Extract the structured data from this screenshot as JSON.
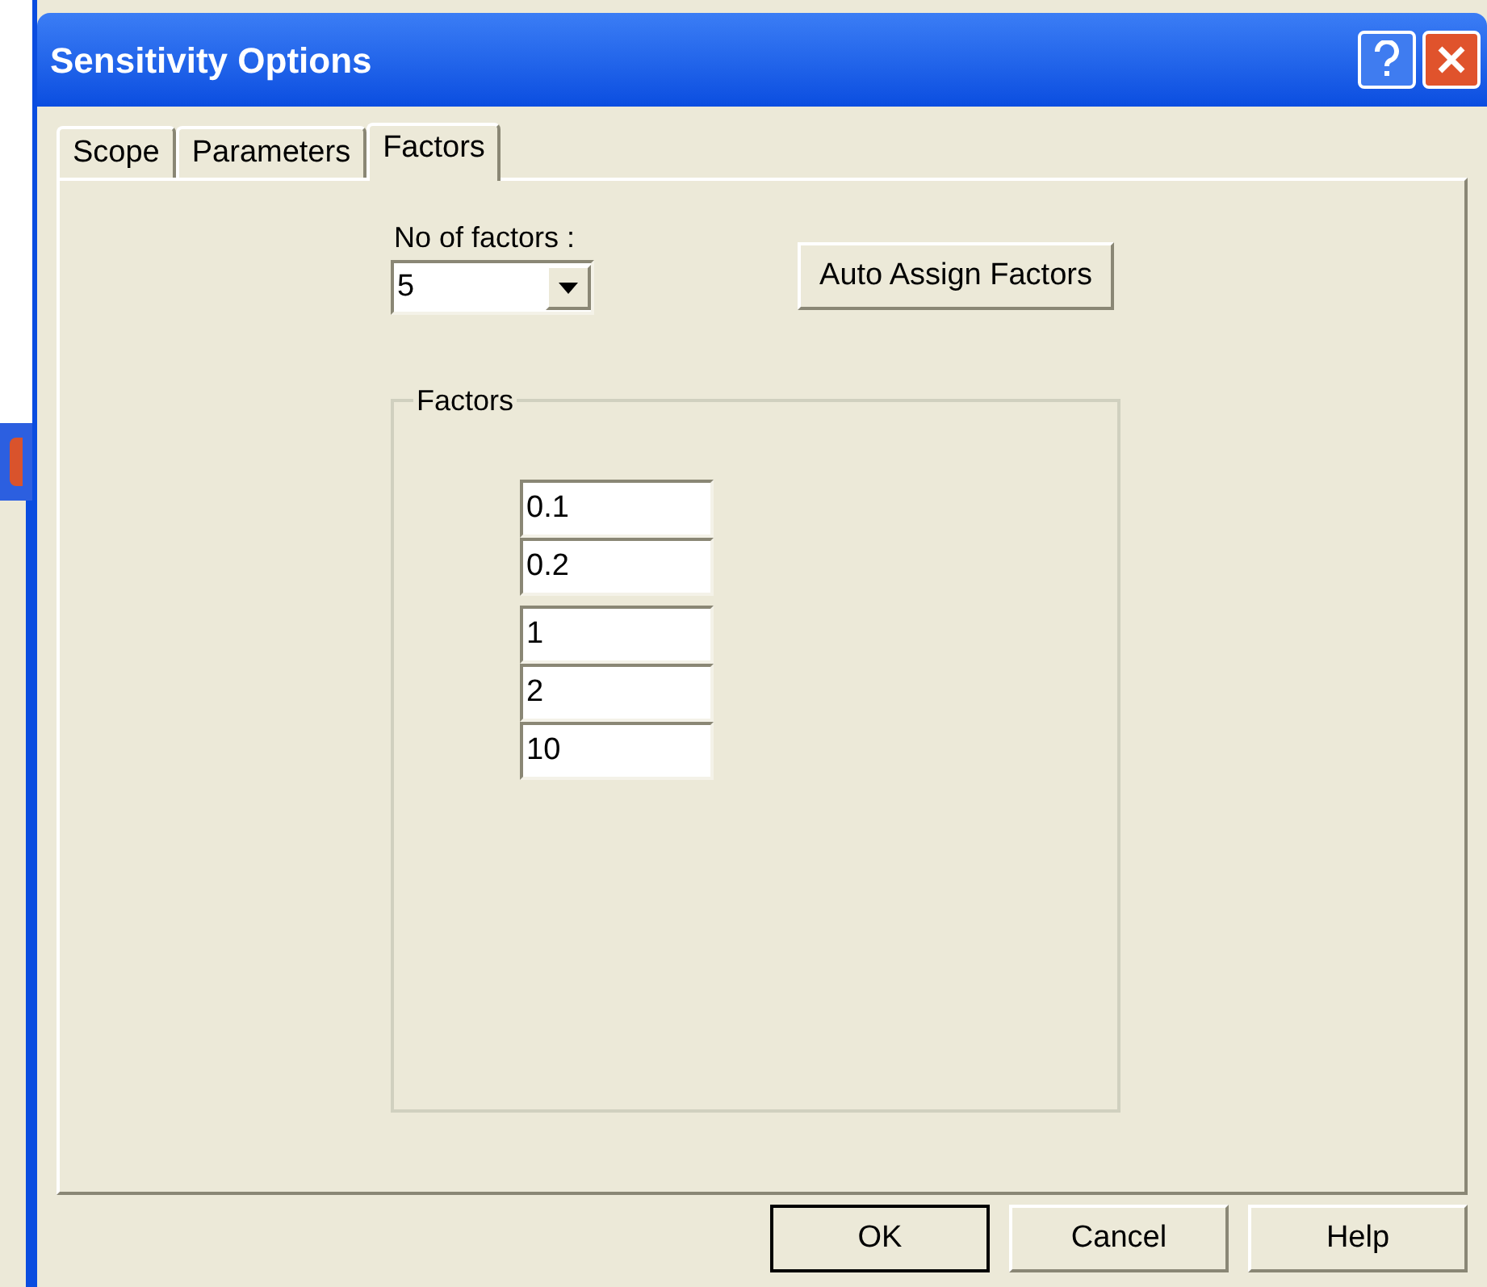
{
  "window": {
    "title": "Sensitivity Options"
  },
  "tabs": [
    {
      "label": "Scope",
      "selected": false
    },
    {
      "label": "Parameters",
      "selected": false
    },
    {
      "label": "Factors",
      "selected": true
    }
  ],
  "no_of_factors": {
    "label": "No of factors :",
    "value": "5"
  },
  "auto_assign_button": "Auto Assign Factors",
  "factors_group": {
    "title": "Factors",
    "values": [
      "0.1",
      "0.2",
      "1",
      "2",
      "10"
    ]
  },
  "buttons": [
    {
      "label": "OK",
      "default": true
    },
    {
      "label": "Cancel",
      "default": false
    },
    {
      "label": "Help",
      "default": false
    }
  ]
}
